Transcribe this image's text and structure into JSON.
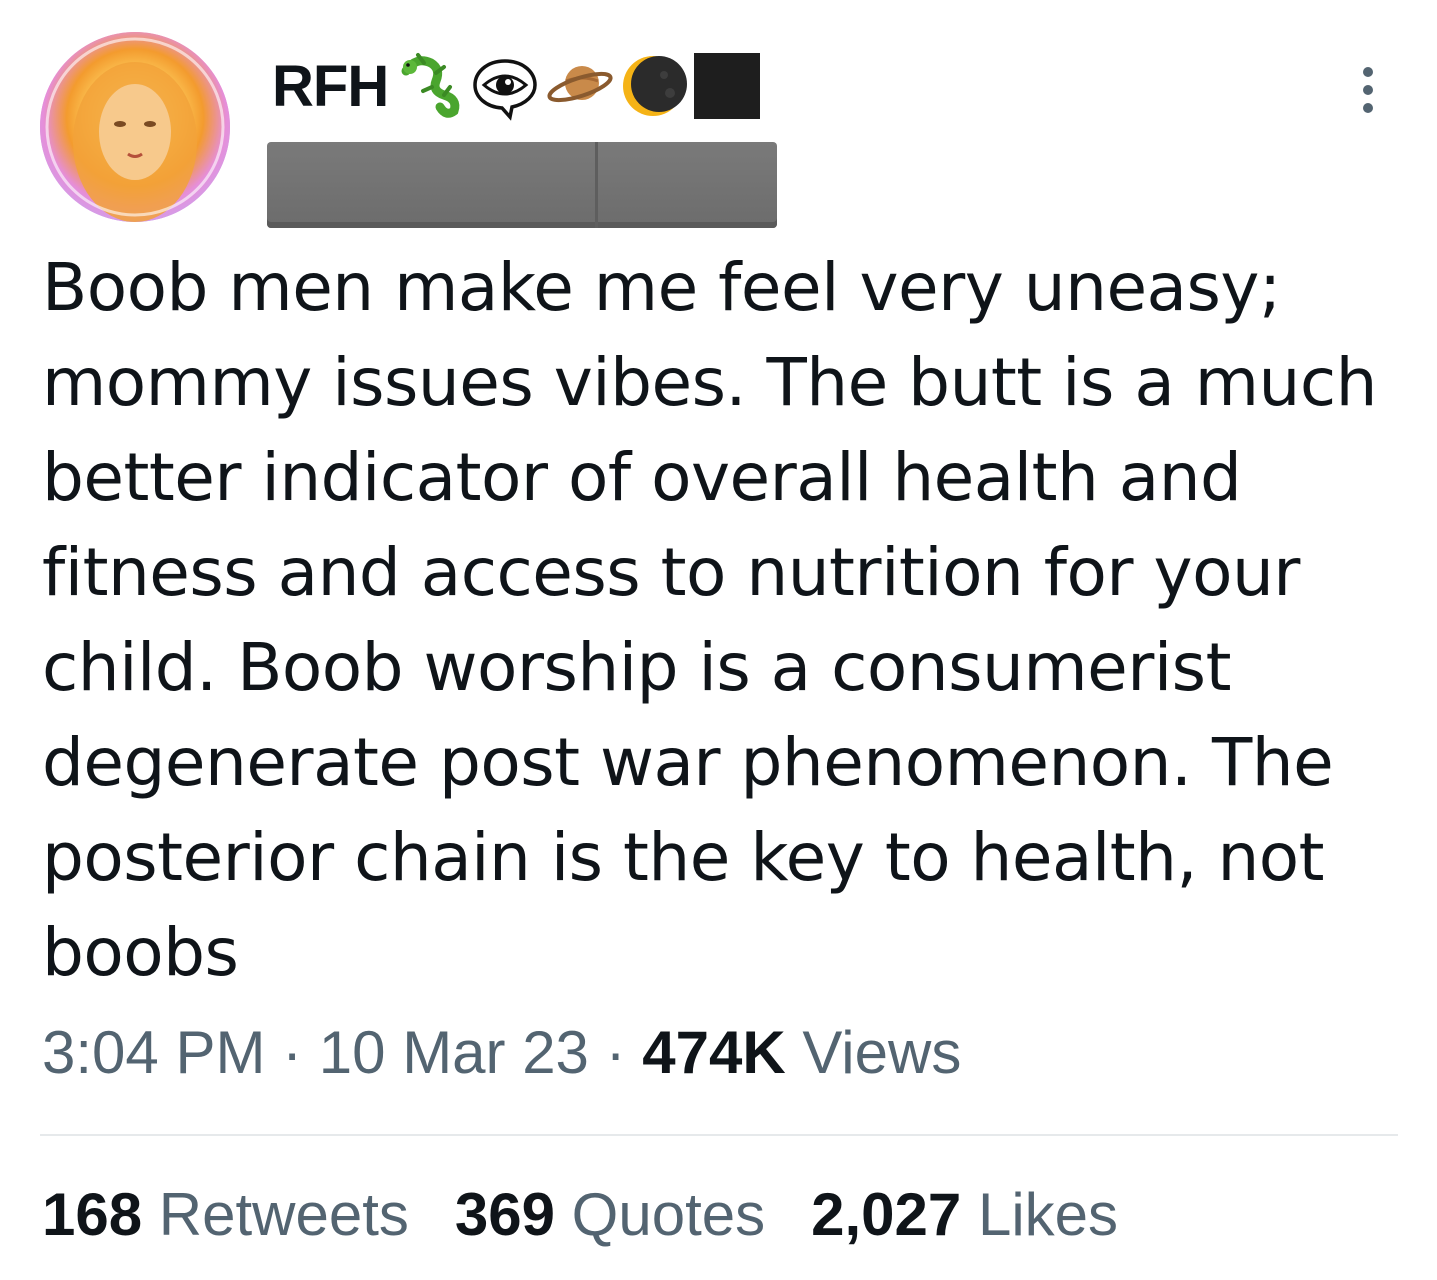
{
  "author": {
    "display_name": "RFH",
    "name_emojis": [
      "lizard-icon",
      "eye-in-speech-bubble-icon",
      "ringed-planet-icon",
      "crescent-moon-icon",
      "black-square-icon"
    ],
    "handle": ""
  },
  "tweet": {
    "text": "Boob men make me feel very uneasy; mommy issues vibes. The butt is a much better indicator of overall health and fitness and access to nutrition for your child. Boob worship is a consumerist degenerate post war phenomenon. The posterior chain is the key to health, not boobs",
    "time": "3:04 PM",
    "separator": "·",
    "date": "10 Mar 23",
    "views_count": "474K",
    "views_label": "Views"
  },
  "stats": {
    "retweets_count": "168",
    "retweets_label": "Retweets",
    "quotes_count": "369",
    "quotes_label": "Quotes",
    "likes_count": "2,027",
    "likes_label": "Likes"
  },
  "colors": {
    "text_primary": "#0f1419",
    "text_secondary": "#536471",
    "divider": "#e6e9eb"
  }
}
